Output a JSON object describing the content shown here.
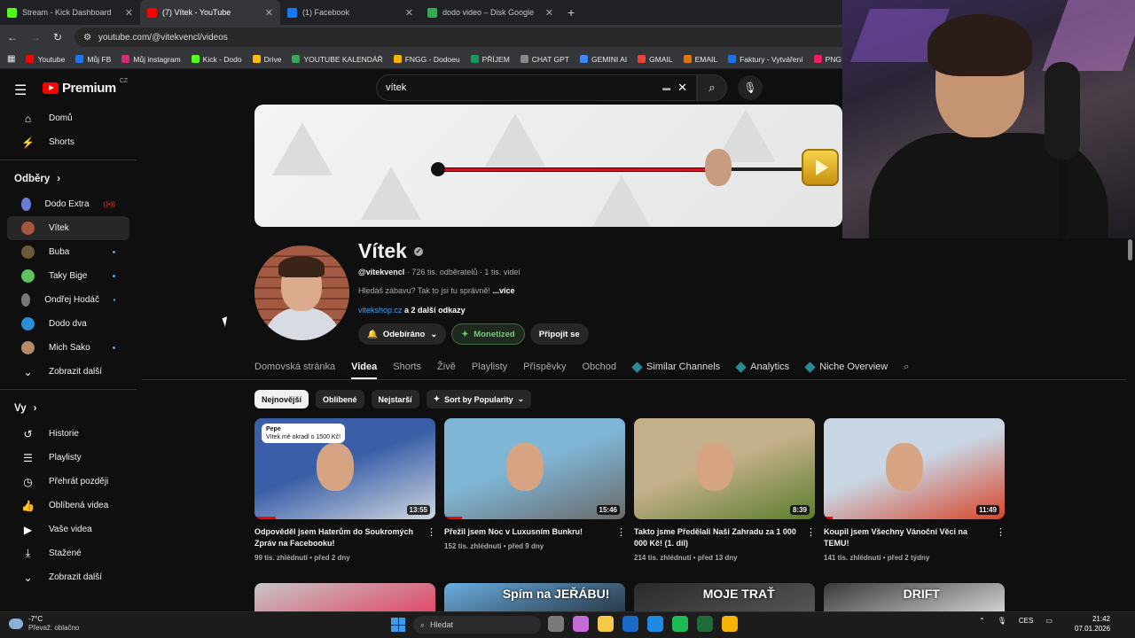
{
  "browser": {
    "tabs": [
      {
        "title": "Stream - Kick Dashboard",
        "color": "#53fc18",
        "active": false
      },
      {
        "title": "(7) Vítek - YouTube",
        "color": "#ff0000",
        "active": true
      },
      {
        "title": "(1) Facebook",
        "color": "#1877f2",
        "active": false
      },
      {
        "title": "dodo video – Disk Google",
        "color": "#34a853",
        "active": false
      }
    ],
    "url": "youtube.com/@vitekvencl/videos",
    "bookmarks": [
      {
        "label": "Youtube",
        "color": "#ff0000"
      },
      {
        "label": "Můj FB",
        "color": "#1877f2"
      },
      {
        "label": "Můj instagram",
        "color": "#d62976"
      },
      {
        "label": "Kick - Dodo",
        "color": "#53fc18"
      },
      {
        "label": "Drive",
        "color": "#fbbc04"
      },
      {
        "label": "YOUTUBE KALENDÁŘ",
        "color": "#34a853"
      },
      {
        "label": "FNGG - Dodoeu",
        "color": "#f4b400"
      },
      {
        "label": "PŘÍJEM",
        "color": "#0f9d58"
      },
      {
        "label": "CHAT GPT",
        "color": "#888888"
      },
      {
        "label": "GEMINI AI",
        "color": "#4285f4"
      },
      {
        "label": "GMAIL",
        "color": "#ea4335"
      },
      {
        "label": "EMAIL",
        "color": "#e37400"
      },
      {
        "label": "Faktury - Vytváření",
        "color": "#1a73e8"
      },
      {
        "label": "PNG to PD",
        "color": "#e91e63"
      }
    ]
  },
  "youtube": {
    "logo_text": "Premium",
    "logo_region": "CZ",
    "search_value": "vítek",
    "sidebar": {
      "main": [
        {
          "label": "Domů",
          "icon": "home-icon",
          "glyph": "⌂"
        },
        {
          "label": "Shorts",
          "icon": "shorts-icon",
          "glyph": "⚡"
        }
      ],
      "subs_heading": "Odběry",
      "subs": [
        {
          "label": "Dodo Extra",
          "color": "#6a7bd8",
          "badge": "live"
        },
        {
          "label": "Vítek",
          "color": "#a3573f",
          "badge": "",
          "selected": true
        },
        {
          "label": "Buba",
          "color": "#6a5a3a",
          "badge": "dot"
        },
        {
          "label": "Taky Bige",
          "color": "#5ec45e",
          "badge": "dot"
        },
        {
          "label": "Ondřej Hodáč",
          "color": "#777777",
          "badge": "dot"
        },
        {
          "label": "Dodo dva",
          "color": "#2b8fd6",
          "badge": ""
        },
        {
          "label": "Mich Sako",
          "color": "#b58a6a",
          "badge": "dot"
        }
      ],
      "subs_more": "Zobrazit další",
      "you_heading": "Vy",
      "you": [
        {
          "label": "Historie",
          "icon": "history-icon",
          "glyph": "↺"
        },
        {
          "label": "Playlisty",
          "icon": "playlist-icon",
          "glyph": "☰"
        },
        {
          "label": "Přehrát později",
          "icon": "watch-later-icon",
          "glyph": "◷"
        },
        {
          "label": "Oblíbená videa",
          "icon": "like-icon",
          "glyph": "👍"
        },
        {
          "label": "Vaše videa",
          "icon": "your-videos-icon",
          "glyph": "▶"
        },
        {
          "label": "Stažené",
          "icon": "download-icon",
          "glyph": "⤓"
        }
      ],
      "you_more": "Zobrazit další"
    },
    "channel": {
      "name": "Vítek",
      "handle": "@vitekvencl",
      "subscribers": "726 tis. odběratelů",
      "videos_count": "1 tis. videí",
      "description": "Hledáš zábavu? Tak to jsi tu správně!",
      "more": "...více",
      "link": "vitekshop.cz",
      "more_links": "a 2 další odkazy",
      "subscribed_label": "Odebíráno",
      "monetized_label": "Monetized",
      "join_label": "Připojit se"
    },
    "tabs": [
      "Domovská stránka",
      "Videa",
      "Shorts",
      "Živě",
      "Playlisty",
      "Příspěvky",
      "Obchod"
    ],
    "active_tab": "Videa",
    "ext_tabs": [
      "Similar Channels",
      "Analytics",
      "Niche Overview"
    ],
    "chips": [
      "Nejnovější",
      "Oblíbené",
      "Nejstarší"
    ],
    "sort_label": "Sort by Popularity",
    "videos": [
      {
        "title": "Odpověděl jsem Haterům do Soukromých Zpráv na Facebooku!",
        "views": "99 tis. zhlédnutí",
        "age": "před 2 dny",
        "duration": "13:55",
        "progress": 0.12,
        "c1": "#3a5fa8",
        "c2": "#cfd6e0",
        "overlay_name": "Pepe",
        "overlay_text": "Vítek mě okradl o 1500 Kč!"
      },
      {
        "title": "Přežil jsem Noc v Luxusním Bunkru!",
        "views": "152 tis. zhlédnutí",
        "age": "před 9 dny",
        "duration": "15:46",
        "progress": 0.1,
        "c1": "#7fb6d6",
        "c2": "#6a6a6a",
        "overlay_name": "",
        "overlay_text": ""
      },
      {
        "title": "Takto jsme Předělali Naši Zahradu za 1 000 000 Kč! (1. díl)",
        "views": "214 tis. zhlédnutí",
        "age": "před 13 dny",
        "duration": "8:39",
        "progress": 0.0,
        "c1": "#c4b08a",
        "c2": "#5b7d2d",
        "overlay_name": "",
        "overlay_text": ""
      },
      {
        "title": "Koupil jsem Všechny Vánoční Věci na TEMU!",
        "views": "141 tis. zhlédnutí",
        "age": "před 2 týdny",
        "duration": "11:49",
        "progress": 0.05,
        "c1": "#c9d6e4",
        "c2": "#d8452a",
        "overlay_name": "",
        "overlay_text": ""
      }
    ],
    "row2": [
      {
        "c1": "#c6c6c6",
        "c2": "#e04a6a",
        "text": ""
      },
      {
        "c1": "#6aaee0",
        "c2": "#2a3a4a",
        "text": "Spím na JEŘÁBU!"
      },
      {
        "c1": "#2a2a2a",
        "c2": "#555555",
        "text": "MOJE TRAŤ"
      },
      {
        "c1": "#3a3a3a",
        "c2": "#cfcfcf",
        "text": "DRIFT"
      }
    ]
  },
  "taskbar": {
    "temp": "-7°C",
    "weather": "Převaž. oblačno",
    "search": "Hledat",
    "lang": "CES",
    "time": "21:42",
    "date": "07.01.2026",
    "apps": [
      "#7a7a7a",
      "#c46bd8",
      "#f7c948",
      "#1b6ac9",
      "#1e88e5",
      "#1db954",
      "#1f6b3a",
      "#f4b400"
    ]
  }
}
